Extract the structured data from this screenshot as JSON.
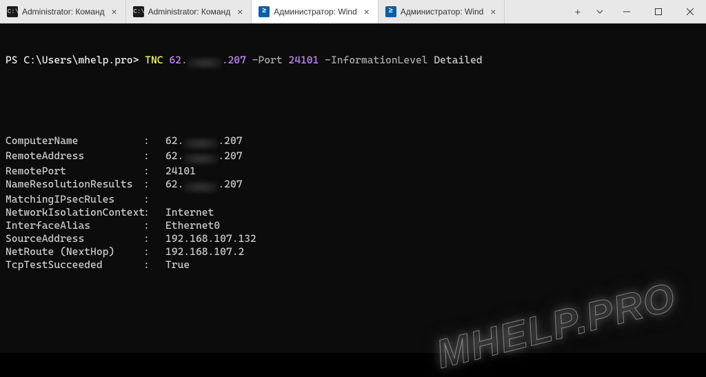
{
  "titlebar": {
    "tabs": [
      {
        "icon": "cmd",
        "title": "Administrator: Команд",
        "active": false
      },
      {
        "icon": "cmd",
        "title": "Administrator: Команд",
        "active": false
      },
      {
        "icon": "ps",
        "title": "Администратор: Wind",
        "active": true
      },
      {
        "icon": "ps",
        "title": "Администратор: Wind",
        "active": false
      }
    ],
    "new_tab_label": "+",
    "dropdown_label": "⌄"
  },
  "prompt": {
    "ps_prefix": "PS ",
    "path": "C:\\Users\\mhelp.pro",
    "sep": "> ",
    "cmdlet": "TNC",
    "ip_pre": "62.",
    "ip_post": ".207",
    "param1": "-Port",
    "port": "24101",
    "param2": "-InformationLevel",
    "level": "Detailed"
  },
  "output": {
    "rows": [
      {
        "k": "ComputerName",
        "v_pre": "62.",
        "v_post": ".207",
        "censored": true
      },
      {
        "k": "RemoteAddress",
        "v_pre": "62.",
        "v_post": ".207",
        "censored": true
      },
      {
        "k": "RemotePort",
        "v": "24101"
      },
      {
        "k": "NameResolutionResults",
        "v_pre": "62.",
        "v_post": ".207",
        "censored": true
      },
      {
        "k": "MatchingIPsecRules",
        "v": ""
      },
      {
        "k": "NetworkIsolationContext",
        "v": "Internet"
      },
      {
        "k": "InterfaceAlias",
        "v": "Ethernet0"
      },
      {
        "k": "SourceAddress",
        "v": "192.168.107.132"
      },
      {
        "k": "NetRoute (NextHop)",
        "v": "192.168.107.2"
      },
      {
        "k": "TcpTestSucceeded",
        "v": "True"
      }
    ]
  },
  "watermark": "MHELP.PRO"
}
